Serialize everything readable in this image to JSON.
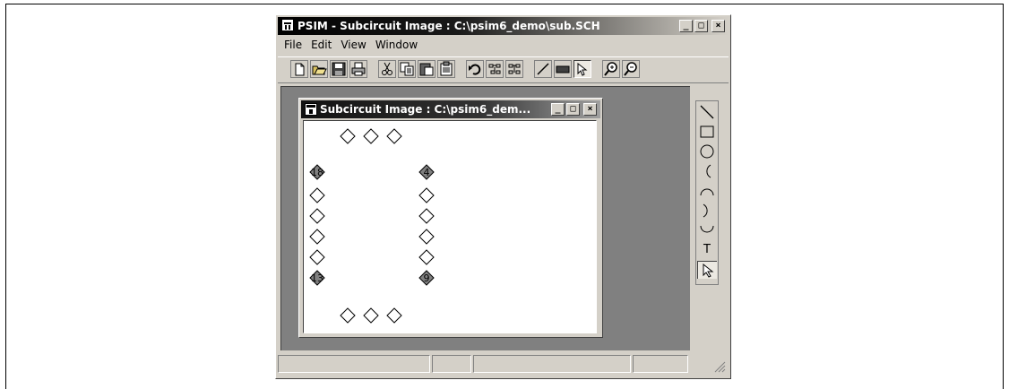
{
  "app": {
    "title": "PSIM - Subcircuit Image : C:\\psim6_demo\\sub.SCH",
    "minimize_glyph": "_",
    "maximize_glyph": "□",
    "close_glyph": "×"
  },
  "menu": {
    "items": [
      {
        "label": "File"
      },
      {
        "label": "Edit"
      },
      {
        "label": "View"
      },
      {
        "label": "Window"
      }
    ]
  },
  "toolbar": {
    "buttons": [
      {
        "icon": "new-file-icon"
      },
      {
        "icon": "open-folder-icon"
      },
      {
        "icon": "save-icon"
      },
      {
        "icon": "print-icon"
      },
      {
        "icon": "cut-icon"
      },
      {
        "icon": "copy-icon"
      },
      {
        "icon": "paste-icon"
      },
      {
        "icon": "clipboard-icon"
      },
      {
        "icon": "undo-icon"
      },
      {
        "icon": "rotate-icon"
      },
      {
        "icon": "flip-icon"
      },
      {
        "icon": "line-icon"
      },
      {
        "icon": "rectangle-icon"
      },
      {
        "icon": "pointer-icon",
        "pressed": true
      },
      {
        "icon": "zoom-in-icon"
      },
      {
        "icon": "zoom-out-icon"
      }
    ]
  },
  "child_window": {
    "title": "Subcircuit Image : C:\\psim6_dem...",
    "minimize_glyph": "_",
    "maximize_glyph": "□",
    "close_glyph": "×"
  },
  "subcircuit": {
    "pin_labels": {
      "top_left": "18",
      "top_right": "4",
      "bottom_left": "13",
      "bottom_right": "9"
    },
    "colors": {
      "pin_fill": "#ffffff",
      "labeled_pin_fill": "#808080",
      "stroke": "#000000"
    }
  },
  "sidebar_tools": [
    {
      "icon": "draw-line-icon"
    },
    {
      "icon": "draw-rectangle-icon"
    },
    {
      "icon": "draw-circle-icon"
    },
    {
      "icon": "draw-arc-left-icon"
    },
    {
      "icon": "draw-arc-top-icon"
    },
    {
      "icon": "draw-arc-right-icon"
    },
    {
      "icon": "draw-arc-bottom-icon"
    },
    {
      "icon": "text-tool-icon",
      "label": "T"
    },
    {
      "icon": "select-pointer-icon",
      "pressed": true
    }
  ],
  "statusbar": {
    "panels": [
      "",
      "",
      "",
      ""
    ]
  }
}
